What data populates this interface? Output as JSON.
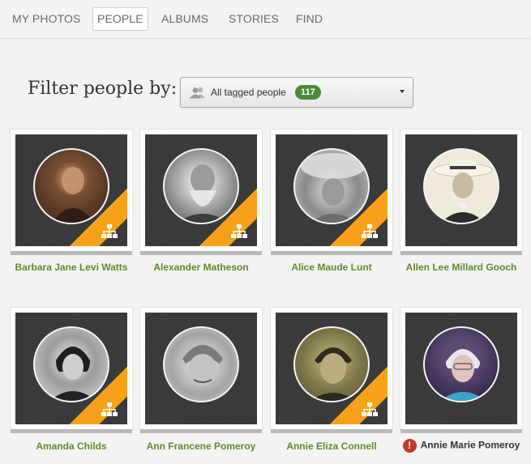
{
  "nav": {
    "tabs": [
      {
        "label": "MY PHOTOS",
        "active": false
      },
      {
        "label": "PEOPLE",
        "active": true
      },
      {
        "label": "ALBUMS",
        "active": false
      },
      {
        "label": "STORIES",
        "active": false
      },
      {
        "label": "FIND",
        "active": false
      }
    ]
  },
  "filter": {
    "label": "Filter people by:",
    "selected": "All tagged people",
    "count": "117",
    "icon": "people-icon"
  },
  "colors": {
    "accent_green": "#5f8c2a",
    "badge_green": "#4c8a3a",
    "ribbon_orange": "#f7a11a",
    "alert_red": "#c4392b"
  },
  "people": [
    {
      "name": "Barbara Jane Levi Watts",
      "tree_ribbon": true,
      "alert": false
    },
    {
      "name": "Alexander Matheson",
      "tree_ribbon": true,
      "alert": false
    },
    {
      "name": "Alice Maude Lunt",
      "tree_ribbon": true,
      "alert": false
    },
    {
      "name": "Allen Lee Millard Gooch",
      "tree_ribbon": false,
      "alert": false
    },
    {
      "name": "Amanda Childs",
      "tree_ribbon": true,
      "alert": false
    },
    {
      "name": "Ann Francene Pomeroy",
      "tree_ribbon": false,
      "alert": false
    },
    {
      "name": "Annie Eliza Connell",
      "tree_ribbon": true,
      "alert": false
    },
    {
      "name": "Annie Marie Pomeroy",
      "tree_ribbon": false,
      "alert": true
    }
  ],
  "alert_symbol": "!"
}
